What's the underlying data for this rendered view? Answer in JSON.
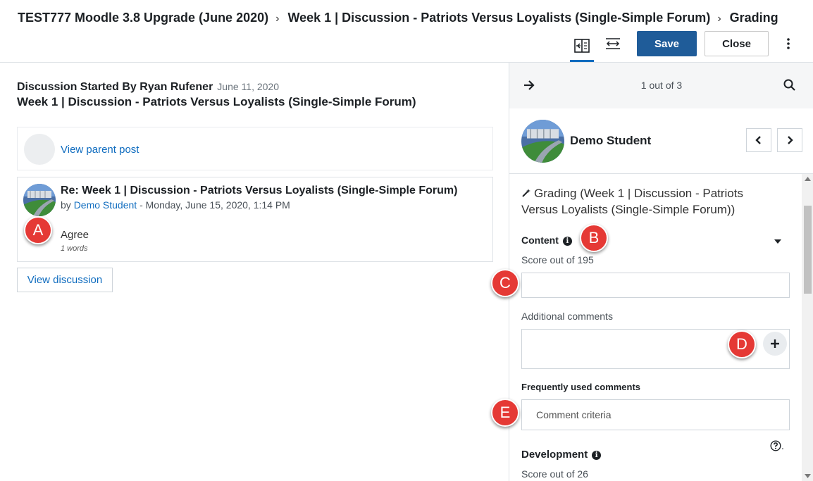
{
  "header": {
    "breadcrumb": [
      "TEST777 Moodle 3.8 Upgrade (June 2020)",
      "Week 1 | Discussion - Patriots Versus Loyalists (Single-Simple Forum)",
      "Grading"
    ],
    "separator": "›",
    "save_label": "Save",
    "close_label": "Close",
    "kebab_icon": "kebab-menu-icon"
  },
  "discussion": {
    "started_by": "Discussion Started By Ryan Rufener",
    "date": "June 11, 2020",
    "title": "Week 1 | Discussion - Patriots Versus Loyalists (Single-Simple Forum)",
    "parent_link": "View parent post",
    "post": {
      "title": "Re: Week 1 | Discussion - Patriots Versus Loyalists (Single-Simple Forum)",
      "by_prefix": "by",
      "author": "Demo Student",
      "timestamp": "- Monday, June 15, 2020, 1:14 PM",
      "body": "Agree",
      "word_count": "1 words"
    },
    "view_discussion": "View discussion"
  },
  "grader": {
    "pager_text": "1 out of 3",
    "student_name": "Demo Student",
    "grading_title": "Grading (Week 1 | Discussion - Patriots Versus Loyalists (Single-Simple Forum))",
    "content_label": "Content",
    "score_label": "Score out of 195",
    "score_value": "",
    "comments_label": "Additional comments",
    "frequent_label": "Frequently used comments",
    "comment_placeholder": "Comment criteria",
    "development_label": "Development",
    "dev_score_label": "Score out of 26",
    "help_suffix": "."
  },
  "markers": [
    "A",
    "B",
    "C",
    "D",
    "E"
  ],
  "colors": {
    "accent": "#0f6cbf",
    "save_bg": "#1f5c99",
    "marker": "#e53935"
  }
}
